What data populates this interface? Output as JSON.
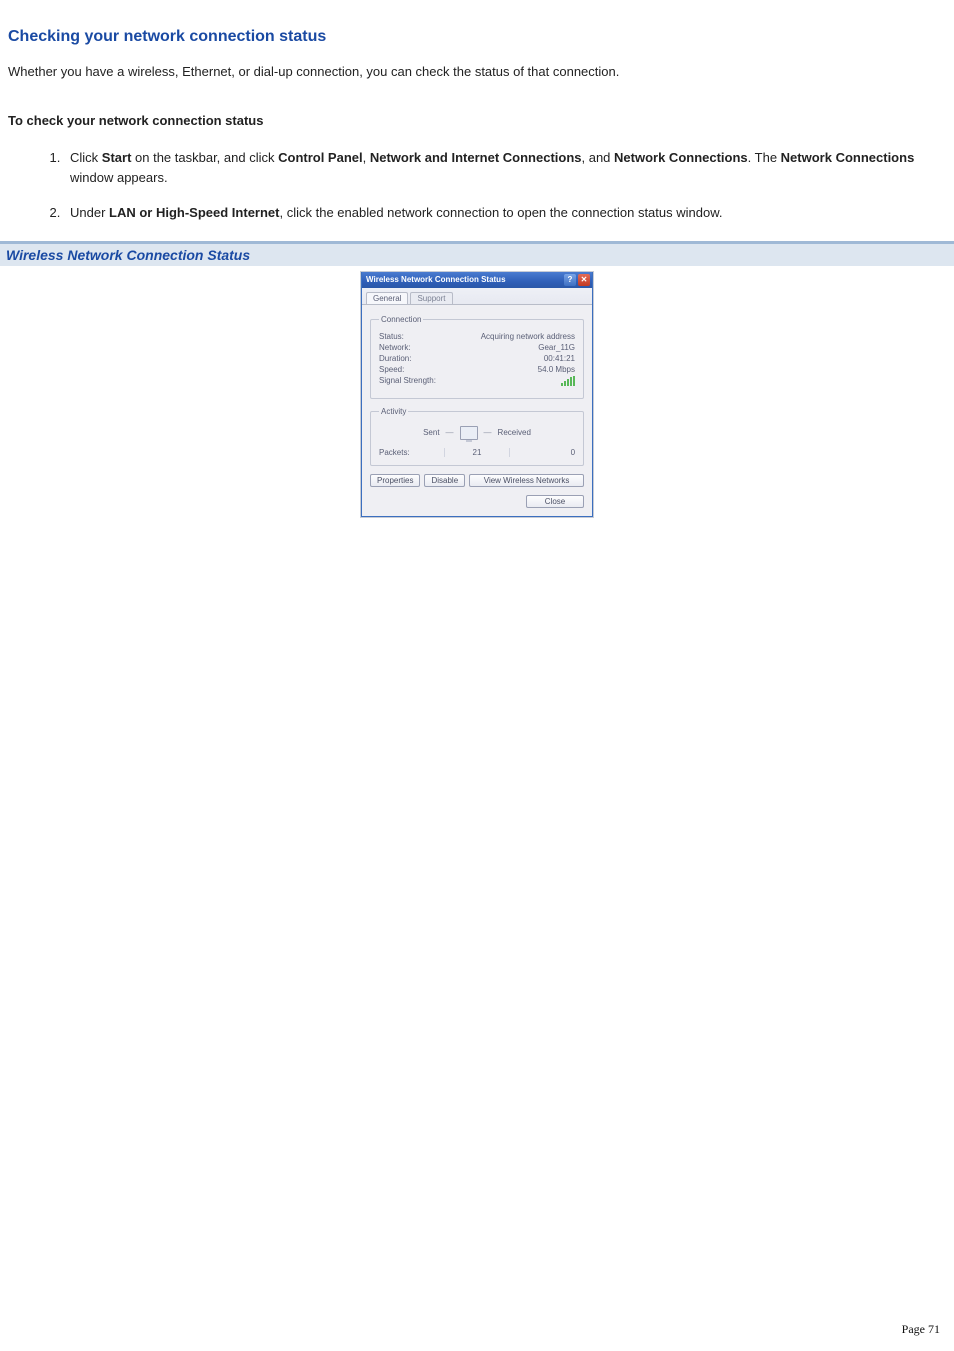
{
  "heading": "Checking your network connection status",
  "intro": "Whether you have a wireless, Ethernet, or dial-up connection, you can check the status of that connection.",
  "subhead": "To check your network connection status",
  "steps": {
    "s1": {
      "a": "Click ",
      "start": "Start",
      "b": " on the taskbar, and click ",
      "cp": "Control Panel",
      "c": ", ",
      "nic": "Network and Internet Connections",
      "d": ", and ",
      "nc": "Network Connections",
      "e": ". The ",
      "nc2": "Network Connections",
      "f": " window appears."
    },
    "s2": {
      "a": "Under ",
      "lan": "LAN or High-Speed Internet",
      "b": ", click the enabled network connection to open the connection status window."
    }
  },
  "caption": "Wireless Network Connection Status",
  "dialog": {
    "title": "Wireless Network Connection Status",
    "help": "?",
    "close": "✕",
    "tabs": {
      "general": "General",
      "support": "Support"
    },
    "connection": {
      "legend": "Connection",
      "status_label": "Status:",
      "status_value": "Acquiring network address",
      "network_label": "Network:",
      "network_value": "Gear_11G",
      "duration_label": "Duration:",
      "duration_value": "00:41:21",
      "speed_label": "Speed:",
      "speed_value": "54.0 Mbps",
      "signal_label": "Signal Strength:"
    },
    "activity": {
      "legend": "Activity",
      "sent": "Sent",
      "received": "Received",
      "packets_label": "Packets:",
      "packets_sent": "21",
      "packets_received": "0"
    },
    "buttons": {
      "properties": "Properties",
      "disable": "Disable",
      "view": "View Wireless Networks",
      "close": "Close"
    }
  },
  "page_number": "Page 71"
}
